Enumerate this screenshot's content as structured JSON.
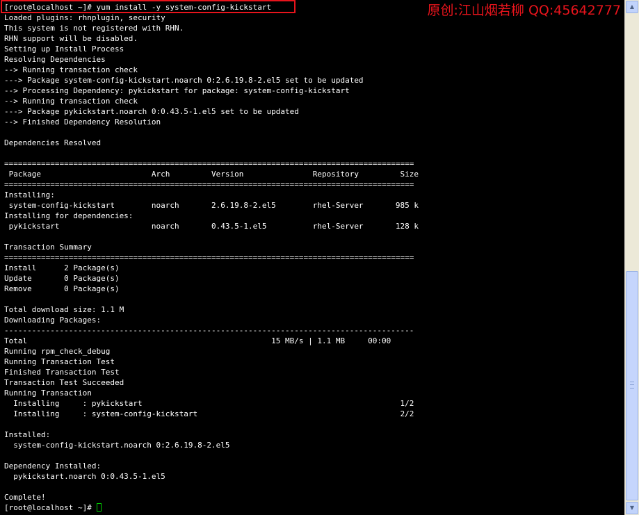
{
  "terminal": {
    "lines": [
      "[root@localhost ~]# yum install -y system-config-kickstart",
      "Loaded plugins: rhnplugin, security",
      "This system is not registered with RHN.",
      "RHN support will be disabled.",
      "Setting up Install Process",
      "Resolving Dependencies",
      "--> Running transaction check",
      "---> Package system-config-kickstart.noarch 0:2.6.19.8-2.el5 set to be updated",
      "--> Processing Dependency: pykickstart for package: system-config-kickstart",
      "--> Running transaction check",
      "---> Package pykickstart.noarch 0:0.43.5-1.el5 set to be updated",
      "--> Finished Dependency Resolution",
      "",
      "Dependencies Resolved",
      "",
      "=========================================================================================",
      " Package                        Arch         Version               Repository         Size",
      "=========================================================================================",
      "Installing:",
      " system-config-kickstart        noarch       2.6.19.8-2.el5        rhel-Server       985 k",
      "Installing for dependencies:",
      " pykickstart                    noarch       0.43.5-1.el5          rhel-Server       128 k",
      "",
      "Transaction Summary",
      "=========================================================================================",
      "Install      2 Package(s)",
      "Update       0 Package(s)",
      "Remove       0 Package(s)",
      "",
      "Total download size: 1.1 M",
      "Downloading Packages:",
      "-----------------------------------------------------------------------------------------",
      "Total                                                     15 MB/s | 1.1 MB     00:00",
      "Running rpm_check_debug",
      "Running Transaction Test",
      "Finished Transaction Test",
      "Transaction Test Succeeded",
      "Running Transaction",
      "  Installing     : pykickstart                                                        1/2",
      "  Installing     : system-config-kickstart                                            2/2",
      "",
      "Installed:",
      "  system-config-kickstart.noarch 0:2.6.19.8-2.el5",
      "",
      "Dependency Installed:",
      "  pykickstart.noarch 0:0.43.5-1.el5",
      "",
      "Complete!"
    ],
    "prompt": "[root@localhost ~]# "
  },
  "watermark": {
    "text": "原创:江山烟若柳  QQ:45642777"
  },
  "colors": {
    "background": "#000000",
    "text": "#ffffff",
    "highlight_border": "#e8141c",
    "watermark": "#e8141c",
    "cursor": "#00d000"
  },
  "scrollbar": {
    "up_icon": "arrow-up-icon",
    "down_icon": "arrow-down-icon"
  }
}
